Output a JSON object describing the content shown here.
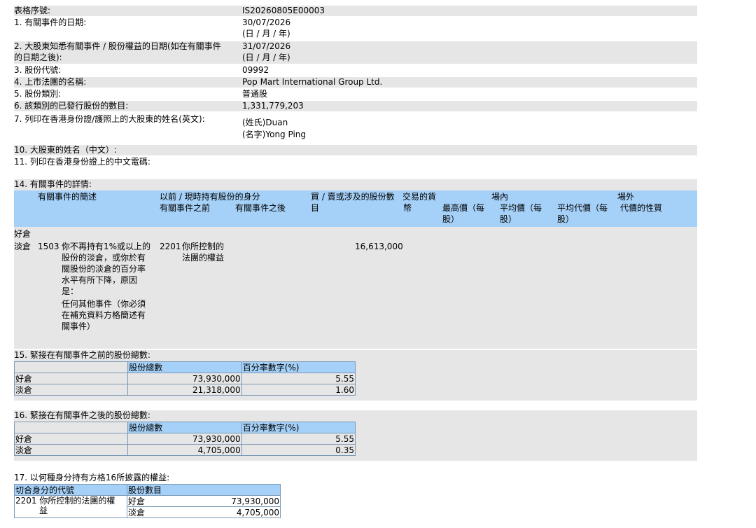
{
  "form": {
    "serial_label": "表格序號:",
    "serial_value": "IS20260805E00003",
    "item1_label": "1. 有關事件的日期:",
    "item1_value": "30/07/2026",
    "item1_format": "(日 / 月 / 年)",
    "item2_label_line1": "2. 大股東知悉有關事件 / 股份權益的日期(如在有關事件",
    "item2_label_line2": "的日期之後):",
    "item2_value": "31/07/2026",
    "item2_format": "(日 / 月 / 年)",
    "item3_label": "3. 股份代號:",
    "item3_value": "09992",
    "item4_label": "4. 上市法團的名稱:",
    "item4_value": "Pop Mart International Group Ltd.",
    "item5_label": "5. 股份類別:",
    "item5_value": "普通股",
    "item6_label": "6. 該類別的已發行股份的數目:",
    "item6_value": "1,331,779,203",
    "item7_label": "7. 列印在香港身份證/護照上的大股東的姓名(英文):",
    "item7_surname": "(姓氏)Duan",
    "item7_given": "(名字)Yong Ping",
    "item10_label": "10. 大股東的姓名（中文）:",
    "item11_label": "11. 列印在香港身份證上的中文電碼:"
  },
  "section14": {
    "title": "14. 有關事件的詳情:",
    "headers": {
      "desc": "有關事件的簡述",
      "capacity": "以前 / 現時持有股份的身分",
      "before": "有關事件之前",
      "after": "有關事件之後",
      "shares_line1": "買 / 賣或涉及的股份數",
      "shares_line2": "目",
      "currency_line1": "交易的貨",
      "currency_line2": "幣",
      "onex": "場內",
      "highest_line1": "最高價（每",
      "highest_line2": "股）",
      "avg_line1": "平均價（每",
      "avg_line2": "股）",
      "offex": "場外",
      "offavg_line1": "平均代價（每",
      "offavg_line2": "股）",
      "nature": "代價的性質"
    },
    "long_label": "好倉",
    "short_label": "淡倉",
    "event_code": "1503",
    "event_desc": [
      "你不再持有1%或以上的",
      "股份的淡倉，或你於有",
      "關股份的淡倉的百分率",
      "水平有所下降，原因",
      "是：",
      "任何其他事件（你必須",
      "在補充資料方格簡述有",
      "關事件）"
    ],
    "capacity_code": "2201",
    "capacity_desc": [
      "你所控制的",
      "法團的權益"
    ],
    "shares": "16,613,000"
  },
  "section15": {
    "title": "15. 緊接在有關事件之前的股份總數:",
    "col_shares": "股份總數",
    "col_pct": "百分率數字(%)",
    "rows": [
      {
        "type": "好倉",
        "shares": "73,930,000",
        "pct": "5.55"
      },
      {
        "type": "淡倉",
        "shares": "21,318,000",
        "pct": "1.60"
      }
    ]
  },
  "section16": {
    "title": "16. 緊接在有關事件之後的股份總數:",
    "col_shares": "股份總數",
    "col_pct": "百分率數字(%)",
    "rows": [
      {
        "type": "好倉",
        "shares": "73,930,000",
        "pct": "5.55"
      },
      {
        "type": "淡倉",
        "shares": "4,705,000",
        "pct": "0.35"
      }
    ]
  },
  "section17": {
    "title": "17. 以何種身分持有方格16所披露的權益:",
    "col_code": "切合身分的代號",
    "col_shares": "股份數目",
    "code": "2201",
    "code_desc_line1": "你所控制的法團的權",
    "code_desc_line2": "益",
    "rows": [
      {
        "type": "好倉",
        "shares": "73,930,000"
      },
      {
        "type": "淡倉",
        "shares": "4,705,000"
      }
    ]
  }
}
